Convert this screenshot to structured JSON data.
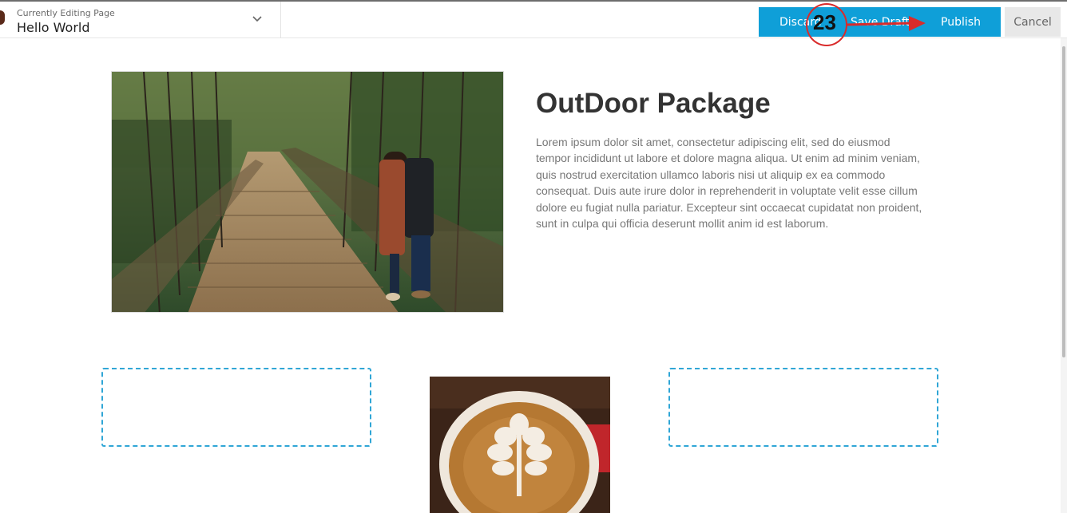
{
  "header": {
    "caption": "Currently Editing Page",
    "page_title": "Hello World"
  },
  "toolbar": {
    "discard_label": "Discard",
    "save_draft_label": "Save Draft",
    "publish_label": "Publish",
    "cancel_label": "Cancel"
  },
  "annotation": {
    "step_number": "23",
    "color": "#d92b2b"
  },
  "content": {
    "heading": "OutDoor Package",
    "paragraph": "Lorem ipsum dolor sit amet, consectetur adipiscing elit, sed do eiusmod tempor incididunt ut labore et dolore magna aliqua. Ut enim ad minim veniam, quis nostrud exercitation ullamco laboris nisi ut aliquip ex ea commodo consequat. Duis aute irure dolor in reprehenderit in voluptate velit esse cillum dolore eu fugiat nulla pariatur. Excepteur sint occaecat cupidatat non proident, sunt in culpa qui officia deserunt mollit anim id est laborum."
  },
  "icons": {
    "page_dropdown": "chevron-down-icon"
  },
  "colors": {
    "accent": "#0f9fd8",
    "placeholder_border": "#30a6d6"
  }
}
